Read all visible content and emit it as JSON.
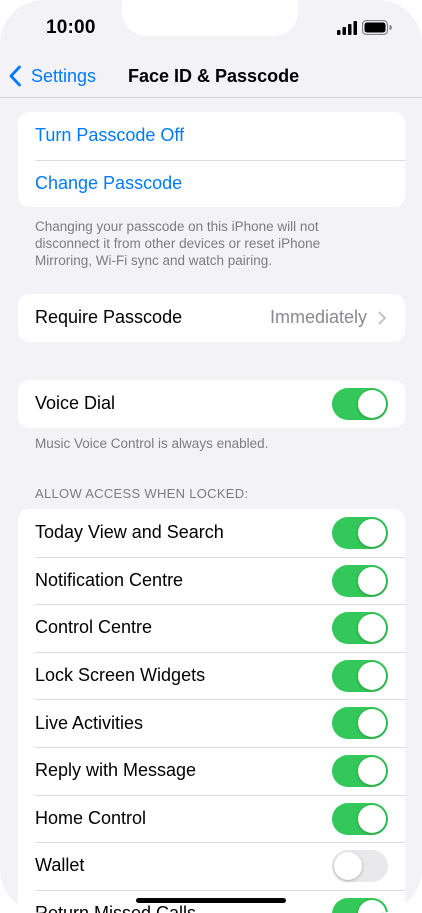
{
  "status_bar": {
    "time": "10:00",
    "signal_icon": "cellular-signal-icon",
    "battery_icon": "battery-icon"
  },
  "nav": {
    "back_label": "Settings",
    "back_icon": "chevron-left-icon",
    "title": "Face ID & Passcode"
  },
  "colors": {
    "accent": "#007aff",
    "toggle_on": "#34c759",
    "toggle_off": "#e9e9eb",
    "background": "#f2f2f7",
    "secondary_text": "#8a8a8e"
  },
  "passcode_group": {
    "turn_off": "Turn Passcode Off",
    "change": "Change Passcode"
  },
  "passcode_footnote": "Changing your passcode on this iPhone will not disconnect it from other devices or reset iPhone Mirroring, Wi-Fi sync and watch pairing.",
  "require_passcode": {
    "label": "Require Passcode",
    "value": "Immediately"
  },
  "voice_dial": {
    "label": "Voice Dial",
    "enabled": true
  },
  "voice_footnote": "Music Voice Control is always enabled.",
  "locked_access": {
    "header": "ALLOW ACCESS WHEN LOCKED:",
    "items": [
      {
        "label": "Today View and Search",
        "enabled": true
      },
      {
        "label": "Notification Centre",
        "enabled": true
      },
      {
        "label": "Control Centre",
        "enabled": true
      },
      {
        "label": "Lock Screen Widgets",
        "enabled": true
      },
      {
        "label": "Live Activities",
        "enabled": true
      },
      {
        "label": "Reply with Message",
        "enabled": true
      },
      {
        "label": "Home Control",
        "enabled": true
      },
      {
        "label": "Wallet",
        "enabled": false
      },
      {
        "label": "Return Missed Calls",
        "enabled": true
      }
    ]
  }
}
